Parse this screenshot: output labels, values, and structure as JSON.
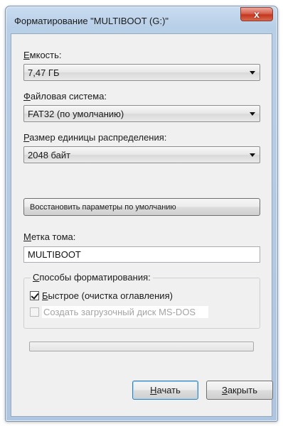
{
  "window": {
    "title": "Форматирование \"MULTIBOOT (G:)\"",
    "close_glyph": "x"
  },
  "capacity": {
    "label_accel": "Е",
    "label_rest": "мкость:",
    "value": "7,47 ГБ"
  },
  "filesystem": {
    "label_accel": "Ф",
    "label_rest": "айловая система:",
    "value": "FAT32 (по умолчанию)"
  },
  "allocation": {
    "label_accel": "Р",
    "label_rest": "азмер единицы распределения:",
    "value": "2048 байт"
  },
  "restore_button": {
    "label": "Восстановить параметры по умолчанию"
  },
  "volume": {
    "label_accel": "М",
    "label_rest": "етка тома:",
    "value": "MULTIBOOT"
  },
  "format_options": {
    "title_accel": "С",
    "title_rest": "пособы форматирования:",
    "quick": {
      "label_accel": "Б",
      "label_rest": "ыстрое (очистка оглавления)",
      "checked": true
    },
    "msdos": {
      "label": "Создать загрузочный диск MS-DOS",
      "checked": false,
      "enabled": false
    }
  },
  "progress": {
    "value": 0
  },
  "buttons": {
    "start_accel": "Н",
    "start_rest": "ачать",
    "close_accel": "З",
    "close_rest": "акрыть"
  }
}
